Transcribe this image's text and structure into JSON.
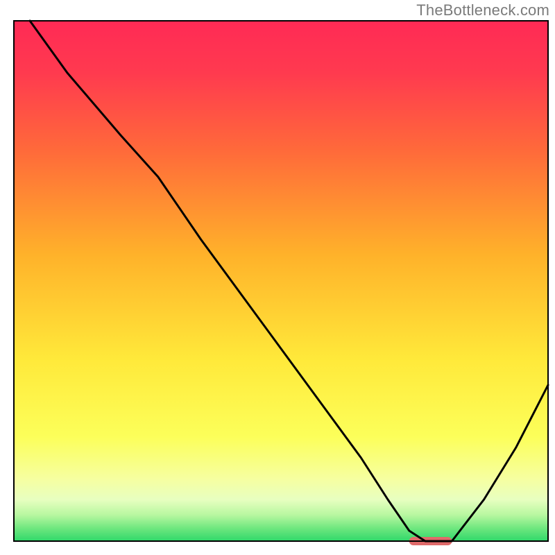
{
  "watermark": "TheBottleneck.com",
  "chart_data": {
    "type": "line",
    "title": "",
    "xlabel": "",
    "ylabel": "",
    "xlim": [
      0,
      100
    ],
    "ylim": [
      0,
      100
    ],
    "background": {
      "gradient_stops": [
        {
          "offset": 0.0,
          "color": "#ff2a55"
        },
        {
          "offset": 0.1,
          "color": "#ff3a4f"
        },
        {
          "offset": 0.25,
          "color": "#ff6a3a"
        },
        {
          "offset": 0.45,
          "color": "#ffb22a"
        },
        {
          "offset": 0.65,
          "color": "#ffe93a"
        },
        {
          "offset": 0.8,
          "color": "#fcff5a"
        },
        {
          "offset": 0.88,
          "color": "#f6ffa0"
        },
        {
          "offset": 0.92,
          "color": "#e8ffc0"
        },
        {
          "offset": 0.95,
          "color": "#b7f7a0"
        },
        {
          "offset": 0.975,
          "color": "#6fe77f"
        },
        {
          "offset": 1.0,
          "color": "#2fd86a"
        }
      ]
    },
    "series": [
      {
        "name": "bottleneck-curve",
        "color": "#000000",
        "width": 3,
        "x": [
          3,
          10,
          20,
          27,
          35,
          45,
          55,
          65,
          70,
          74,
          77,
          82,
          88,
          94,
          100
        ],
        "y": [
          100,
          90,
          78,
          70,
          58,
          44,
          30,
          16,
          8,
          2,
          0,
          0,
          8,
          18,
          30
        ]
      }
    ],
    "marker": {
      "name": "optimum-marker",
      "color": "#e06a6a",
      "x_start": 74,
      "x_end": 82,
      "y": 0,
      "thickness": 12,
      "rx": 6
    },
    "frame": {
      "inset_left": 20,
      "inset_right": 10,
      "inset_top": 30,
      "inset_bottom": 20,
      "stroke": "#000000",
      "stroke_width": 2
    }
  }
}
